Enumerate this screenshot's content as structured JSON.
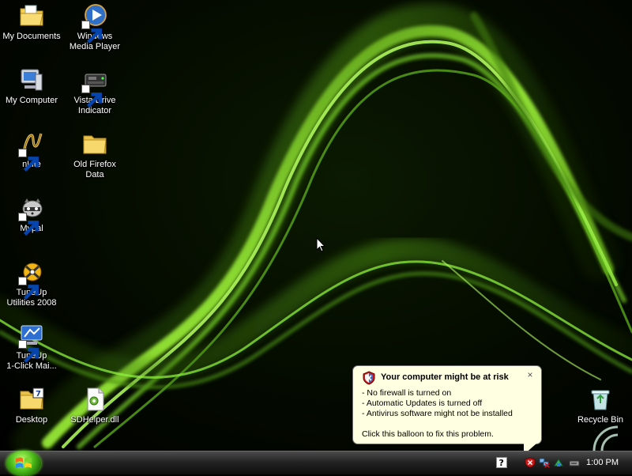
{
  "desktop": {
    "icons": [
      {
        "label": "My Documents",
        "icon": "folder-documents-icon"
      },
      {
        "label": "Windows\nMedia Player",
        "icon": "media-player-icon"
      },
      {
        "label": "My Computer",
        "icon": "computer-icon"
      },
      {
        "label": "Vista Drive\nIndicator",
        "icon": "drive-indicator-icon"
      },
      {
        "label": "nLite",
        "icon": "nlite-icon"
      },
      {
        "label": "Old Firefox\nData",
        "icon": "folder-icon"
      },
      {
        "label": "Mypal",
        "icon": "mypal-raccoon-icon"
      },
      {
        "label": "TuneUp\nUtilities 2008",
        "icon": "tuneup-icon"
      },
      {
        "label": "TuneUp\n1-Click Mai...",
        "icon": "tuneup-oneclick-icon"
      },
      {
        "label": "Desktop",
        "icon": "desktop-folder-icon"
      },
      {
        "label": "SDHelper.dll",
        "icon": "dll-file-icon"
      },
      {
        "label": "Recycle Bin",
        "icon": "recycle-bin-icon"
      }
    ]
  },
  "balloon": {
    "title": "Your computer might be at risk",
    "close": "×",
    "lines": [
      "- No firewall is turned on",
      "- Automatic Updates is turned off",
      "- Antivirus software might not be installed"
    ],
    "footer": "Click this balloon to fix this problem."
  },
  "taskbar": {
    "clock": "1:00 PM",
    "tray_icons": [
      "help-icon",
      "security-center-shield-icon",
      "network-disconnected-icon",
      "network-icon",
      "safely-remove-icon"
    ]
  },
  "colors": {
    "accent": "#7dff2e",
    "balloon_bg": "#ffffe1",
    "shield_red": "#cc1b1b"
  }
}
